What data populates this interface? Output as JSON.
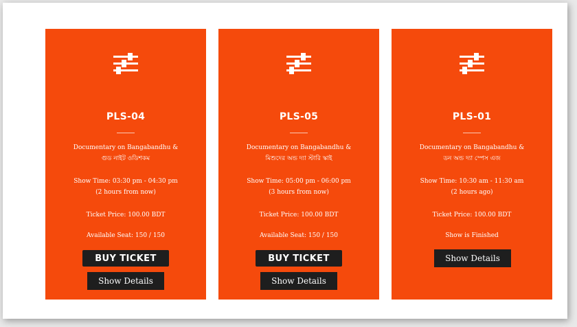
{
  "cards": [
    {
      "title": "PLS-04",
      "desc_line1": "Documentary on Bangabandhu &",
      "desc_line2": "গুড নাইট ওডিশকম",
      "time_line1": "Show Time: 03:30 pm - 04:30 pm",
      "time_line2": "(2 hours from now)",
      "price": "Ticket Price: 100.00 BDT",
      "status": "Available Seat: 150 / 150",
      "buy_label": "BUY TICKET",
      "details_label": "Show Details"
    },
    {
      "title": "PLS-05",
      "desc_line1": "Documentary on Bangabandhu &",
      "desc_line2": "মিশুদের অন্ড দ্যা স্টারি স্কাই",
      "time_line1": "Show Time: 05:00 pm - 06:00 pm",
      "time_line2": "(3 hours from now)",
      "price": "Ticket Price: 100.00 BDT",
      "status": "Available Seat: 150 / 150",
      "buy_label": "BUY TICKET",
      "details_label": "Show Details"
    },
    {
      "title": "PLS-01",
      "desc_line1": "Documentary on Bangabandhu &",
      "desc_line2": "ডন অন্ড দ্যা স্পেস এজ",
      "time_line1": "Show Time: 10:30 am - 11:30 am",
      "time_line2": "(2 hours ago)",
      "price": "Ticket Price: 100.00 BDT",
      "status": "Show is Finished",
      "details_label": "Show Details"
    }
  ],
  "icons": {
    "card_icon": "sliders-icon"
  },
  "colors": {
    "card_bg": "#f54a0c",
    "button_bg": "#1e1e1e",
    "text": "#ffffff"
  }
}
